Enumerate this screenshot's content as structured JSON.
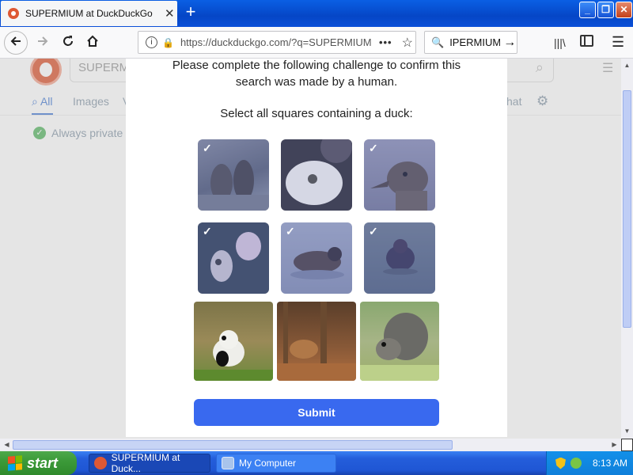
{
  "browser": {
    "tab_title": "SUPERMIUM at DuckDuckGo",
    "tab_close": "✕",
    "new_tab": "+",
    "url": "https://duckduckgo.com/?q=SUPERMIUM",
    "url_info": "i",
    "search_query": "IPERMIUM",
    "window_min": "_",
    "window_max": "❐",
    "window_close": "✕"
  },
  "ddg": {
    "search_value": "SUPERMIUM",
    "tabs": [
      "All",
      "Images",
      "V",
      "hat"
    ],
    "private_text": "Always private"
  },
  "challenge": {
    "heading_line1": "Please complete the following challenge to confirm this",
    "heading_line2": "search was made by a human.",
    "instruction": "Select all squares containing a duck:",
    "submit_label": "Submit",
    "check_mark": "✓",
    "cells": [
      {
        "name": "sea-lions",
        "checked": true
      },
      {
        "name": "seal",
        "checked": false
      },
      {
        "name": "duck-head",
        "checked": true
      },
      {
        "name": "dogs",
        "checked": true
      },
      {
        "name": "swimming-duck",
        "checked": true
      },
      {
        "name": "duck-on-water",
        "checked": true
      },
      {
        "name": "panda",
        "checked": false
      },
      {
        "name": "capybara",
        "checked": false
      },
      {
        "name": "squirrel",
        "checked": false
      }
    ]
  },
  "taskbar": {
    "start_label": "start",
    "task1": "SUPERMIUM at Duck...",
    "task2": "My Computer",
    "clock": "8:13 AM"
  }
}
